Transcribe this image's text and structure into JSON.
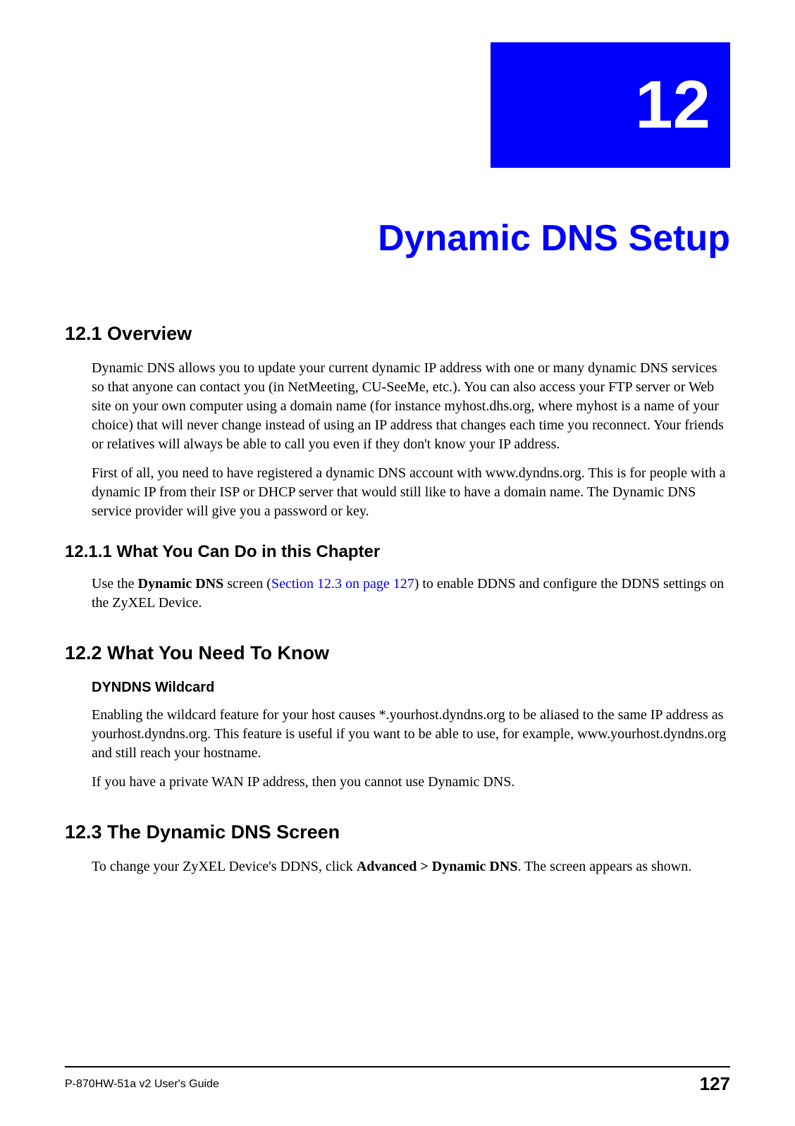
{
  "chapter": {
    "number": "12",
    "title": "Dynamic DNS Setup"
  },
  "sections": {
    "s12_1": {
      "heading": "12.1  Overview",
      "para1": "Dynamic DNS allows you to update your current dynamic IP address with one or many dynamic DNS services so that anyone can contact you (in NetMeeting, CU-SeeMe, etc.). You can also access your FTP server or Web site on your own computer using a domain name (for instance myhost.dhs.org, where myhost is a name of your choice) that will never change instead of using an IP address that changes each time you reconnect. Your friends or relatives will always be able to call you even if they don't know your IP address.",
      "para2": "First of all, you need to have registered a dynamic DNS account with www.dyndns.org. This is for people with a dynamic IP from their ISP or DHCP server that would still like to have a domain name. The Dynamic DNS service provider will give you a password or key."
    },
    "s12_1_1": {
      "heading": "12.1.1  What You Can Do in this Chapter",
      "para_parts": {
        "pre": "Use the ",
        "bold1": "Dynamic DNS",
        "mid1": " screen (",
        "link": "Section 12.3 on page 127",
        "post": ") to enable DDNS and configure the DDNS settings on the ZyXEL Device."
      }
    },
    "s12_2": {
      "heading": "12.2  What You Need To Know",
      "sub_heading": "DYNDNS Wildcard",
      "para1": "Enabling the wildcard feature for your host causes *.yourhost.dyndns.org to be aliased to the same IP address as yourhost.dyndns.org. This feature is useful if you want to be able to use, for example, www.yourhost.dyndns.org and still reach your hostname.",
      "para2": "If you have a private WAN IP address, then you cannot use Dynamic DNS."
    },
    "s12_3": {
      "heading": "12.3  The Dynamic DNS Screen",
      "para_parts": {
        "pre": "To change your ZyXEL Device's DDNS, click ",
        "bold1": "Advanced > Dynamic DNS",
        "post": ". The screen appears as shown."
      }
    }
  },
  "footer": {
    "guide": "P-870HW-51a v2 User's Guide",
    "page": "127"
  }
}
